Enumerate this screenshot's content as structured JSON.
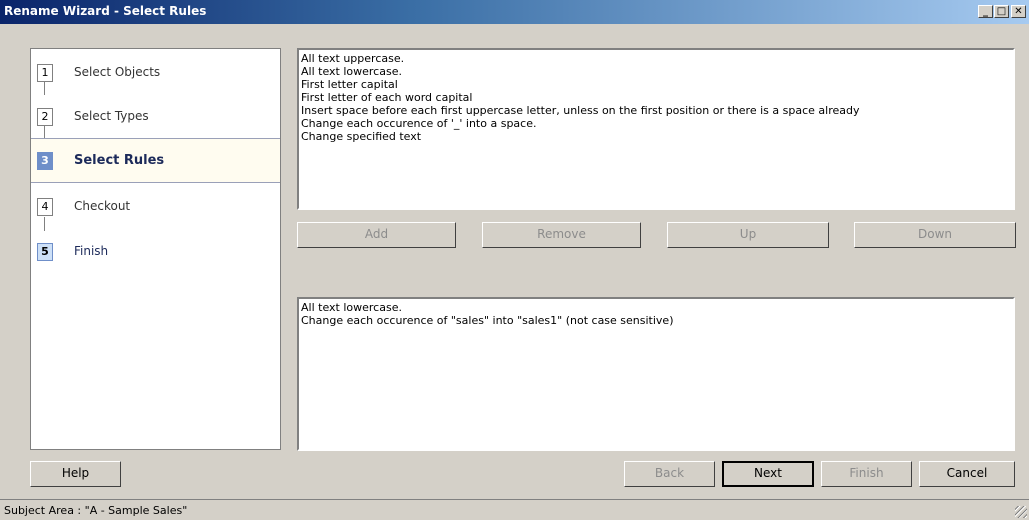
{
  "window": {
    "title": "Rename Wizard - Select Rules",
    "controls": {
      "minimize": "_",
      "maximize": "□",
      "close": "✕"
    }
  },
  "steps": [
    {
      "num": "1",
      "label": "Select Objects",
      "state": "done"
    },
    {
      "num": "2",
      "label": "Select Types",
      "state": "done"
    },
    {
      "num": "3",
      "label": "Select Rules",
      "state": "active"
    },
    {
      "num": "4",
      "label": "Checkout",
      "state": "pending"
    },
    {
      "num": "5",
      "label": "Finish",
      "state": "pending"
    }
  ],
  "available_rules": [
    "All text uppercase.",
    "All text lowercase.",
    "First letter capital",
    "First letter of each word capital",
    "Insert space before each first uppercase letter, unless on the first position or there is a space already",
    "Change each occurence of '_' into a space.",
    "Change specified text"
  ],
  "rule_buttons": {
    "add": "Add",
    "remove": "Remove",
    "up": "Up",
    "down": "Down"
  },
  "selected_rules": [
    "All text lowercase.",
    "Change each occurence of \"sales\" into \"sales1\" (not case sensitive)"
  ],
  "footer_buttons": {
    "help": "Help",
    "back": "Back",
    "next": "Next",
    "finish": "Finish",
    "cancel": "Cancel"
  },
  "status": {
    "text": "Subject Area : \"A - Sample Sales\""
  }
}
